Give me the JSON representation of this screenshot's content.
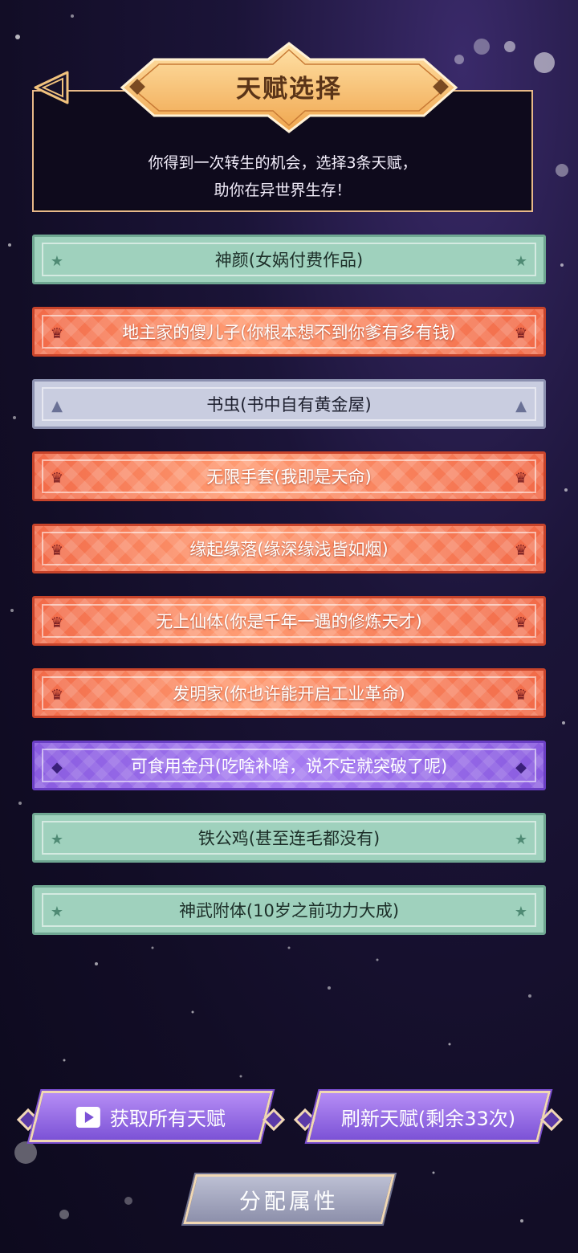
{
  "header": {
    "title": "天赋选择",
    "intro_line1": "你得到一次转生的机会，选择3条天赋，",
    "intro_line2": "助你在异世界生存！"
  },
  "talents": [
    {
      "label": "神颜(女娲付费作品)",
      "tier": "green",
      "icon": "star-icon"
    },
    {
      "label": "地主家的傻儿子(你根本想不到你爹有多有钱)",
      "tier": "red",
      "icon": "crown-icon"
    },
    {
      "label": "书虫(书中自有黄金屋)",
      "tier": "gray",
      "icon": "triangle-icon"
    },
    {
      "label": "无限手套(我即是天命)",
      "tier": "red",
      "icon": "crown-icon"
    },
    {
      "label": "缘起缘落(缘深缘浅皆如烟)",
      "tier": "red",
      "icon": "crown-icon"
    },
    {
      "label": "无上仙体(你是千年一遇的修炼天才)",
      "tier": "red",
      "icon": "crown-icon"
    },
    {
      "label": "发明家(你也许能开启工业革命)",
      "tier": "red",
      "icon": "crown-icon"
    },
    {
      "label": "可食用金丹(吃啥补啥，说不定就突破了呢)",
      "tier": "purple",
      "icon": "gem-icon"
    },
    {
      "label": "铁公鸡(甚至连毛都没有)",
      "tier": "green",
      "icon": "star-icon"
    },
    {
      "label": "神武附体(10岁之前功力大成)",
      "tier": "green",
      "icon": "star-icon"
    }
  ],
  "buttons": {
    "get_all": "获取所有天赋",
    "refresh": "刷新天赋(剩余33次)",
    "allocate": "分配属性"
  },
  "colors": {
    "green": "#9fd1bd",
    "red": "#f26a48",
    "gray": "#c9cde0",
    "purple": "#8a5ce0",
    "gold": "#f1c27d"
  }
}
